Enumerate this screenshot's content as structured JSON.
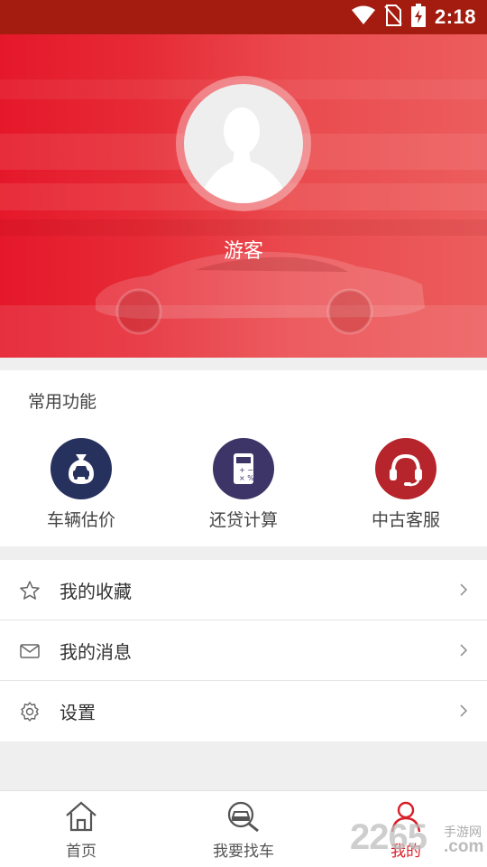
{
  "status_bar": {
    "time": "2:18"
  },
  "profile": {
    "username": "游客"
  },
  "common_functions": {
    "title": "常用功能",
    "items": [
      {
        "label": "车辆估价",
        "icon": "car-valuation-icon",
        "color": "#27315e"
      },
      {
        "label": "还贷计算",
        "icon": "calculator-icon",
        "color": "#3d3467"
      },
      {
        "label": "中古客服",
        "icon": "headset-icon",
        "color": "#b6252b"
      }
    ]
  },
  "menu": [
    {
      "label": "我的收藏",
      "icon": "star-icon"
    },
    {
      "label": "我的消息",
      "icon": "mail-icon"
    },
    {
      "label": "设置",
      "icon": "gear-icon"
    }
  ],
  "bottom_nav": {
    "tabs": [
      {
        "label": "首页",
        "icon": "home-icon",
        "active": false
      },
      {
        "label": "我要找车",
        "icon": "car-search-icon",
        "active": false
      },
      {
        "label": "我的",
        "icon": "person-icon",
        "active": true
      }
    ]
  },
  "watermark": {
    "text": "2265",
    "subtext": "手游网",
    "domain": ".com"
  },
  "colors": {
    "accent": "#d7202a",
    "status_bar": "#a31c0f"
  }
}
